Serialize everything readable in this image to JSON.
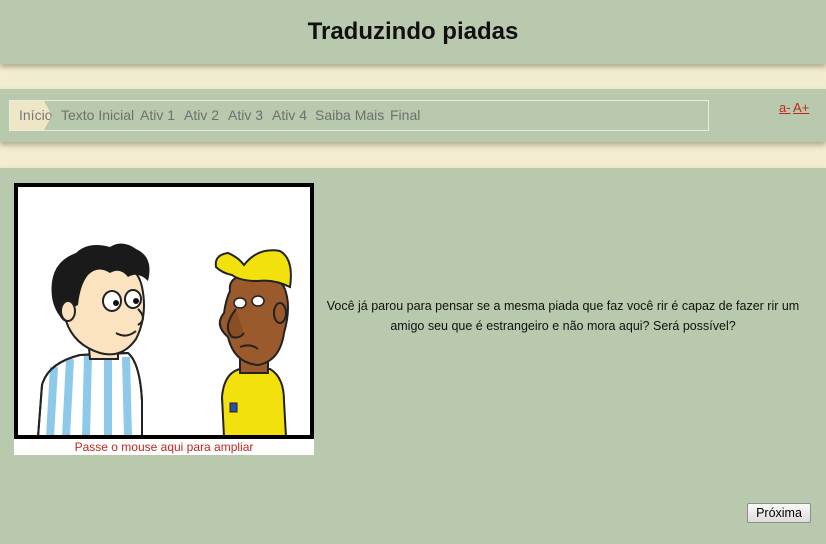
{
  "header": {
    "title": "Traduzindo piadas"
  },
  "nav": {
    "items": [
      {
        "label": "Início",
        "active": true
      },
      {
        "label": "Texto Inicial"
      },
      {
        "label": "Ativ 1"
      },
      {
        "label": "Ativ 2"
      },
      {
        "label": "Ativ 3"
      },
      {
        "label": "Ativ 4"
      },
      {
        "label": "Saiba Mais"
      },
      {
        "label": "Final"
      }
    ],
    "font_decrease": "a-",
    "font_increase": "A+"
  },
  "main": {
    "image_caption": "Passe o mouse aqui para ampliar",
    "question": "Você já parou para pensar se a mesma piada que faz você rir é capaz de fazer rir um amigo seu que é estrangeiro e não mora aqui? Será possível?",
    "next_button": "Próxima"
  },
  "colors": {
    "panel": "#b8c9ae",
    "background": "#f2ecd0",
    "link": "#c0271e",
    "active_tab": "#efe6c6"
  }
}
